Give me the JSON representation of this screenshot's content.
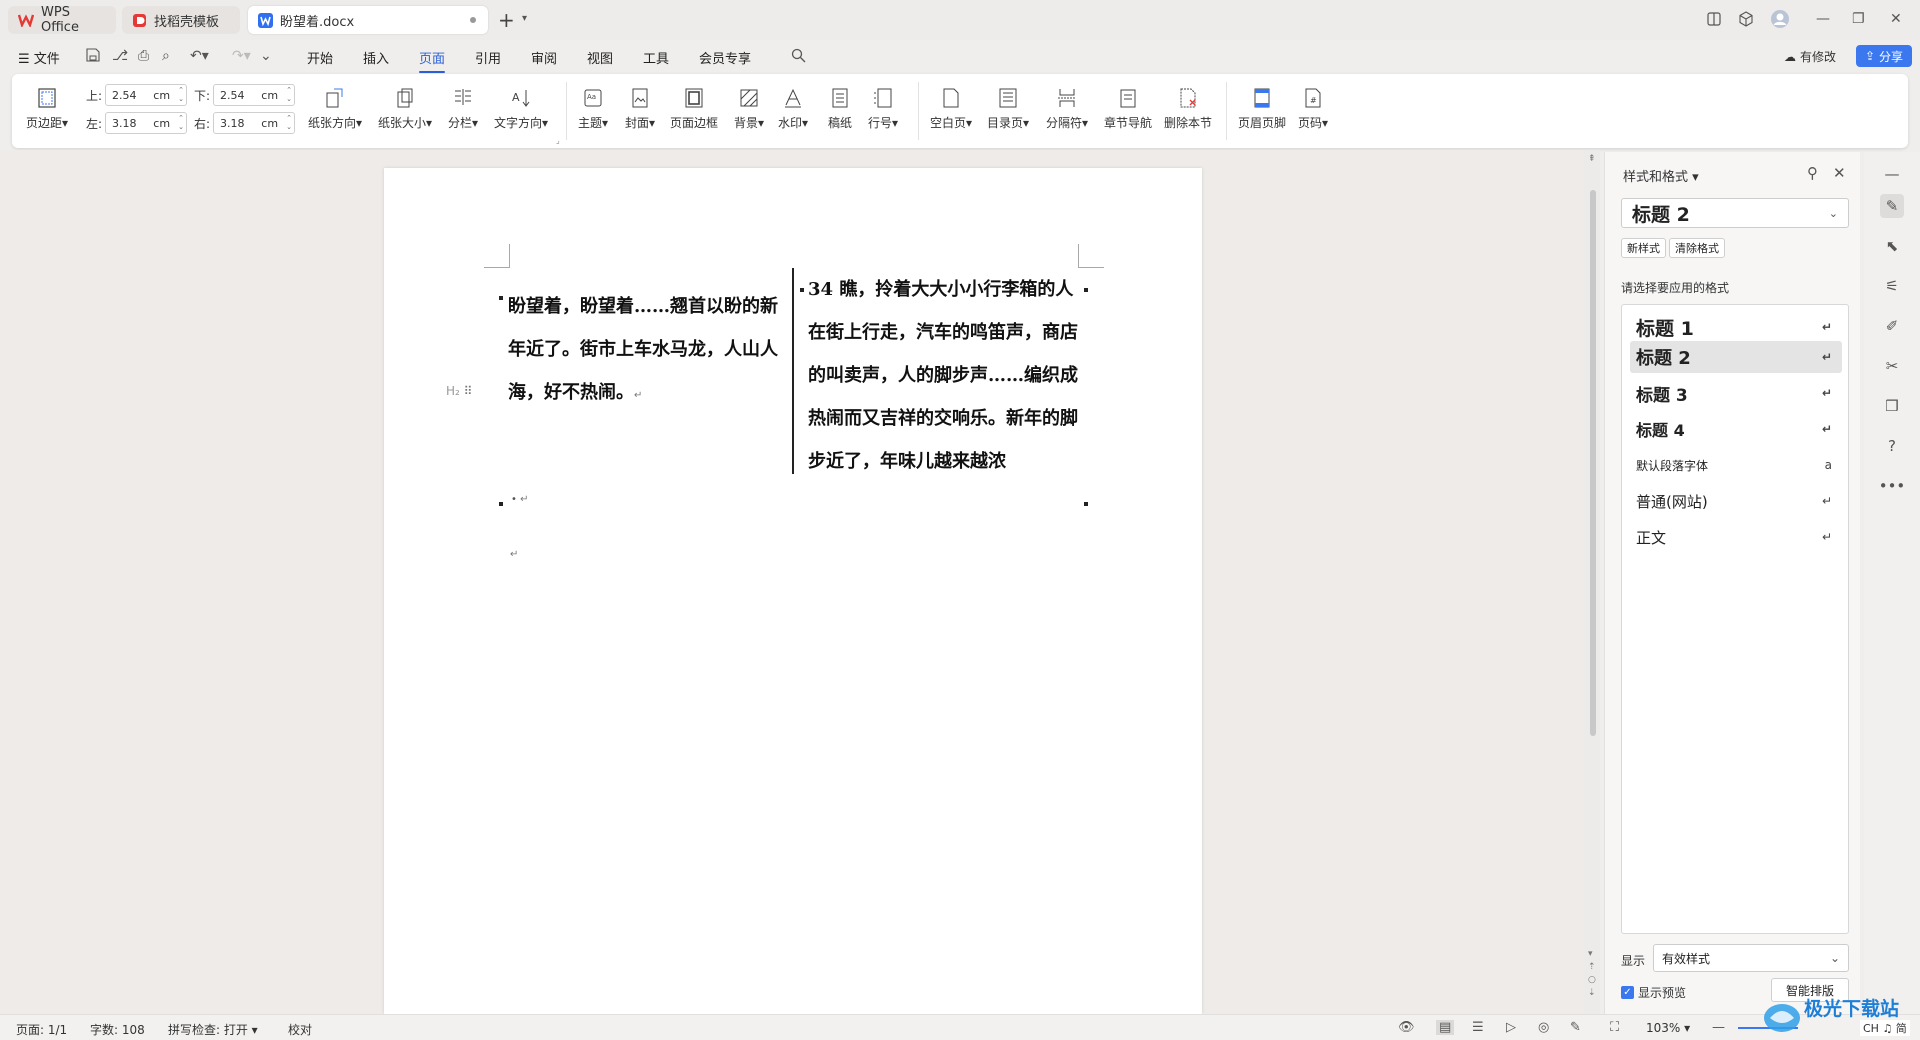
{
  "colors": {
    "accent": "#2b5fd9",
    "share_bg": "#3b78f0",
    "wps_red": "#e53935",
    "doc_blue": "#2f6ff0"
  },
  "tabs": [
    {
      "label": "WPS Office",
      "icon": "wps-logo-icon"
    },
    {
      "label": "找稻壳模板",
      "icon": "docer-icon"
    },
    {
      "label": "盼望着.docx",
      "icon": "word-doc-icon"
    }
  ],
  "menu": {
    "file": "文件",
    "items": [
      "开始",
      "插入",
      "页面",
      "引用",
      "审阅",
      "视图",
      "工具",
      "会员专享"
    ],
    "active": "页面",
    "edited": "有修改",
    "share": "分享"
  },
  "ribbon": {
    "margins": {
      "label": "页边距",
      "top_label": "上:",
      "top": "2.54",
      "bottom_label": "下:",
      "bottom": "2.54",
      "left_label": "左:",
      "left": "3.18",
      "right_label": "右:",
      "right": "3.18",
      "unit": "cm"
    },
    "buttons": [
      "纸张方向",
      "纸张大小",
      "分栏",
      "文字方向",
      "主题",
      "封面",
      "页面边框",
      "背景",
      "水印",
      "稿纸",
      "行号",
      "空白页",
      "目录页",
      "分隔符",
      "章节导航",
      "删除本节",
      "页眉页脚",
      "页码"
    ]
  },
  "document": {
    "col1": "盼望着，盼望着……翘首以盼的新年近了。街市上车水马龙，人山人海，好不热闹。",
    "col2": "34 瞧，拎着大大小小行李箱的人在街上行走，汽车的鸣笛声，商店的叫卖声，人的脚步声……编织成热闹而又吉祥的交响乐。新年的脚步近了，年味儿越来越浓",
    "heading_marker": "H₂",
    "para_mark": "↵"
  },
  "panel": {
    "title": "样式和格式",
    "current_style": "标题 2",
    "new_style": "新样式",
    "clear_format": "清除格式",
    "apply_label": "请选择要应用的格式",
    "styles": [
      {
        "name": "标题 1",
        "mark": "↵"
      },
      {
        "name": "标题 2",
        "mark": "↵"
      },
      {
        "name": "标题 3",
        "mark": "↵"
      },
      {
        "name": "标题 4",
        "mark": "↵"
      },
      {
        "name": "默认段落字体",
        "mark": "a"
      },
      {
        "name": "普通(网站)",
        "mark": "↵"
      },
      {
        "name": "正文",
        "mark": "↵"
      }
    ],
    "selected_style": "标题 2",
    "show_label": "显示",
    "show_value": "有效样式",
    "preview_label": "显示预览",
    "smart_button": "智能排版"
  },
  "status": {
    "page": "页面: 1/1",
    "words": "字数: 108",
    "spell": "拼写检查: 打开",
    "proof": "校对",
    "zoom": "103%"
  },
  "watermark": {
    "text": "极光下载站",
    "sub": "CH ♫ 简"
  }
}
